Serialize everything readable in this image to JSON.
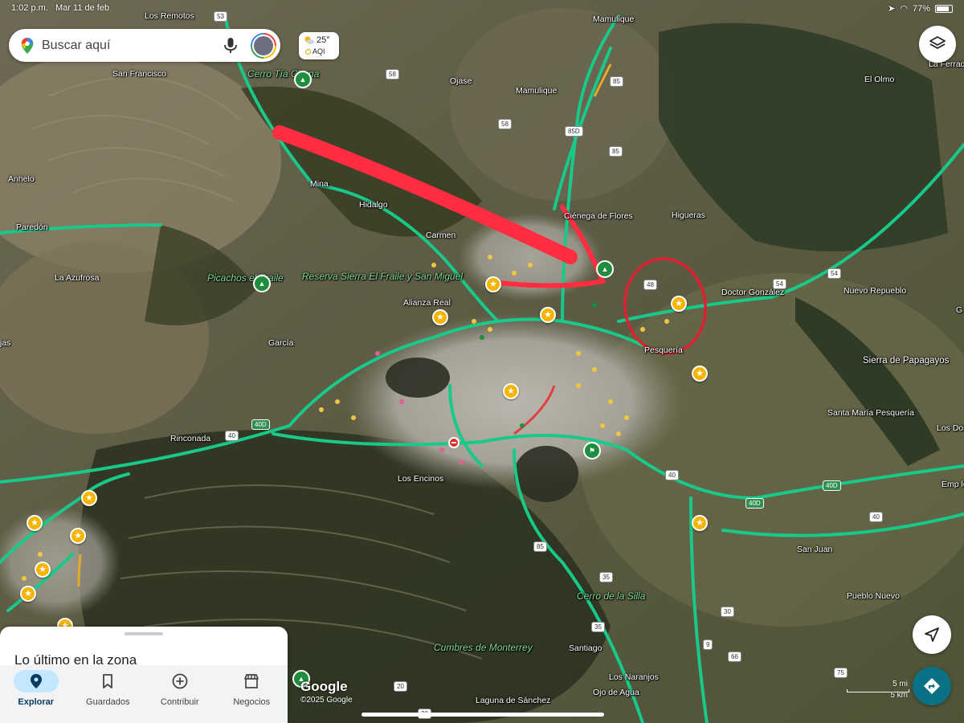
{
  "status_bar": {
    "time": "1:02 p.m.",
    "date": "Mar 11 de feb",
    "battery": "77%"
  },
  "search": {
    "placeholder": "Buscar aquí"
  },
  "weather": {
    "temp": "25°",
    "aqi": "AQI"
  },
  "map": {
    "places": [
      {
        "name": "Los Remotos"
      },
      {
        "name": "Mamulique"
      },
      {
        "name": "San Francisco"
      },
      {
        "name": "Cerro Tía Chena"
      },
      {
        "name": "Ojase"
      },
      {
        "name": "Mamulique"
      },
      {
        "name": "El Olmo"
      },
      {
        "name": "La Ferrada"
      },
      {
        "name": "Anhelo"
      },
      {
        "name": "Mina"
      },
      {
        "name": "Hidalgo"
      },
      {
        "name": "Ciénega de Flores"
      },
      {
        "name": "Higueras"
      },
      {
        "name": "Paredón"
      },
      {
        "name": "Carmen"
      },
      {
        "name": "La Azufrosa"
      },
      {
        "name": "Picachos el Fraile"
      },
      {
        "name": "Reserva Sierra El Fraile y San Miguel"
      },
      {
        "name": "Alianza Real"
      },
      {
        "name": "Doctor González"
      },
      {
        "name": "Nuevo Repueblo"
      },
      {
        "name": "García"
      },
      {
        "name": "Pesquería"
      },
      {
        "name": "Sierra de Papagayos"
      },
      {
        "name": "Santa María Pesquería"
      },
      {
        "name": "Rinconada"
      },
      {
        "name": "Los Encinos"
      },
      {
        "name": "Los Dos"
      },
      {
        "name": "Emp los Ram"
      },
      {
        "name": "San Juan"
      },
      {
        "name": "Cerro de la Silla"
      },
      {
        "name": "Pueblo Nuevo"
      },
      {
        "name": "Cumbres de Monterrey"
      },
      {
        "name": "Santiago"
      },
      {
        "name": "Los Naranjos"
      },
      {
        "name": "Ojo de Agua"
      },
      {
        "name": "Laguna de Sánchez"
      },
      {
        "name": "jas"
      },
      {
        "name": "G"
      }
    ],
    "shields": [
      "53",
      "58",
      "85",
      "58",
      "85D",
      "85",
      "48",
      "54",
      "54",
      "40D",
      "40",
      "40",
      "40D",
      "40D",
      "40",
      "85",
      "35",
      "35",
      "30",
      "9",
      "66",
      "20",
      "20",
      "75"
    ]
  },
  "sheet": {
    "title": "Lo último en la zona"
  },
  "nav": {
    "items": [
      {
        "label": "Explorar",
        "icon": "location-pin-icon"
      },
      {
        "label": "Guardados",
        "icon": "bookmark-icon"
      },
      {
        "label": "Contribuir",
        "icon": "add-circle-icon"
      },
      {
        "label": "Negocios",
        "icon": "storefront-icon"
      }
    ]
  },
  "attribution": {
    "logo": "Google",
    "copyright": "©2025 Google"
  },
  "scale": {
    "mi": "5 mi",
    "km": "5 km"
  },
  "colors": {
    "road": "#19c98a",
    "annotation": "#ff2d3f",
    "poi": "#f4b400"
  }
}
